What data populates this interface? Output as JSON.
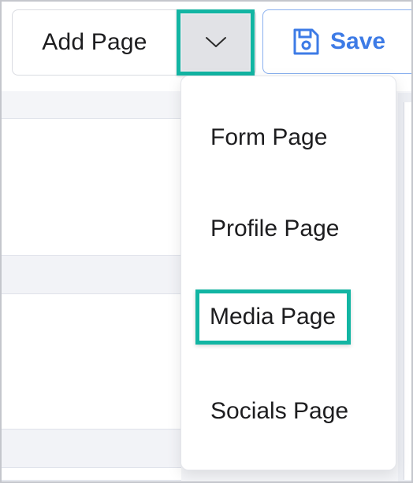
{
  "toolbar": {
    "add_page_label": "Add Page",
    "save_label": "Save"
  },
  "icons": {
    "dropdown_toggle": "chevron-down-icon",
    "save": "floppy-disk-icon"
  },
  "dropdown": {
    "items": [
      {
        "label": "Form Page",
        "highlighted": false
      },
      {
        "label": "Profile Page",
        "highlighted": false
      },
      {
        "label": "Media Page",
        "highlighted": true
      },
      {
        "label": "Socials Page",
        "highlighted": false
      }
    ]
  },
  "colors": {
    "highlight_border": "#12b5a3",
    "save_text": "#3d7be6",
    "save_border": "#8ab0ef"
  }
}
